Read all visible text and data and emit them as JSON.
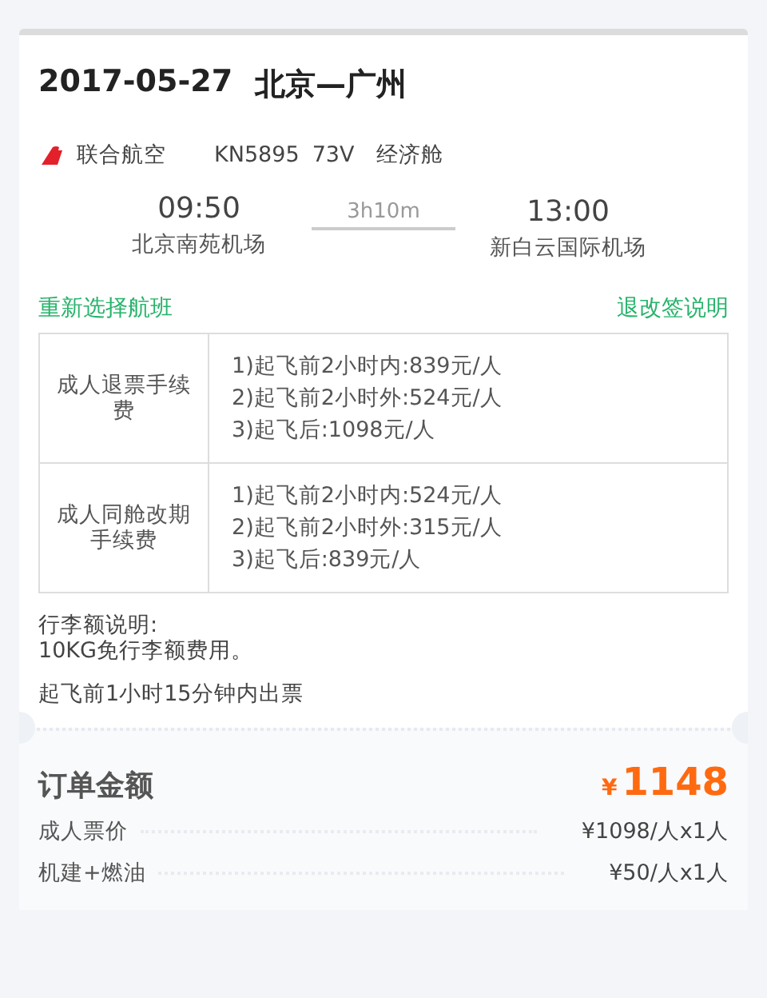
{
  "header": {
    "date": "2017-05-27",
    "route": "北京—广州"
  },
  "flight": {
    "airline": "联合航空",
    "flight_no": "KN5895",
    "aircraft": "73V",
    "cabin": "经济舱",
    "depart_time": "09:50",
    "depart_airport": "北京南苑机场",
    "duration": "3h10m",
    "arrive_time": "13:00",
    "arrive_airport": "新白云国际机场"
  },
  "links": {
    "rechoose": "重新选择航班",
    "rules": "退改签说明"
  },
  "fees": [
    {
      "label": "成人退票手续费",
      "lines": [
        "1)起飞前2小时内:839元/人",
        "2)起飞前2小时外:524元/人",
        "3)起飞后:1098元/人"
      ]
    },
    {
      "label": "成人同舱改期手续费",
      "lines": [
        "1)起飞前2小时内:524元/人",
        "2)起飞前2小时外:315元/人",
        "3)起飞后:839元/人"
      ]
    }
  ],
  "baggage": {
    "title": "行李额说明:",
    "text": "10KG免行李额费用。"
  },
  "ticketing_note": "起飞前1小时15分钟内出票",
  "summary": {
    "title": "订单金额",
    "currency": "¥",
    "total": "1148",
    "items": [
      {
        "label": "成人票价",
        "value": "¥1098/人x1人"
      },
      {
        "label": "机建+燃油",
        "value": "¥50/人x1人"
      }
    ]
  }
}
